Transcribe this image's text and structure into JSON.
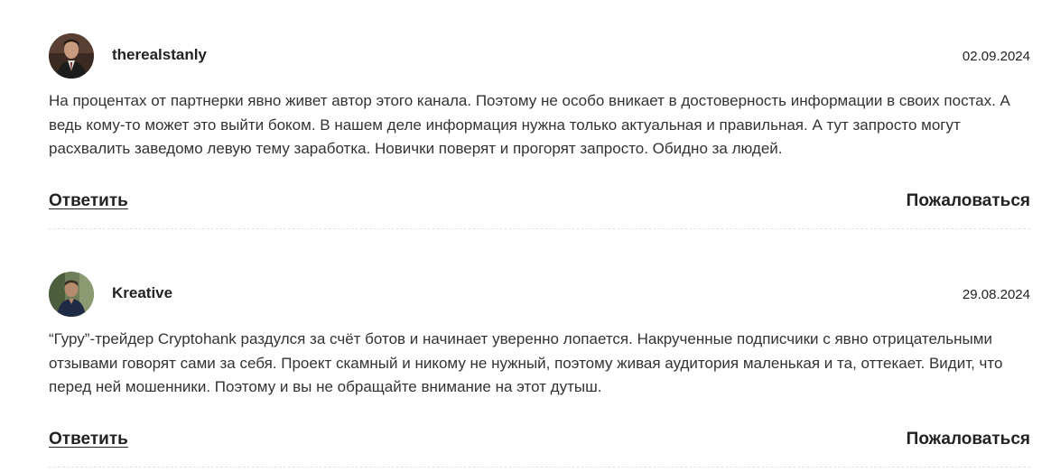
{
  "comments": [
    {
      "username": "therealstanly",
      "date": "02.09.2024",
      "text": "На процентах от партнерки явно живет автор этого канала. Поэтому не особо вникает в достоверность информации в своих постах. А ведь кому-то может это выйти боком. В нашем деле информация нужна только актуальная и правильная. А тут запросто могут расхвалить заведомо левую тему заработка. Новички поверят и прогорят запросто. Обидно за людей.",
      "reply_label": "Ответить",
      "report_label": "Пожаловаться"
    },
    {
      "username": "Kreative",
      "date": "29.08.2024",
      "text": "“Гуру”-трейдер Cryptohank раздулся за счёт ботов и начинает уверенно лопается. Накрученные подписчики с явно отрицательными отзывами говорят сами за себя. Проект скамный и никому не нужный, поэтому живая аудитория маленькая и та, оттекает. Видит, что перед ней мошенники. Поэтому и вы не обращайте внимание на этот дутыш.",
      "reply_label": "Ответить",
      "report_label": "Пожаловаться"
    }
  ],
  "colors": {
    "text": "#222222",
    "body_text": "#333333",
    "divider": "#e2e2e2",
    "background": "#ffffff"
  }
}
